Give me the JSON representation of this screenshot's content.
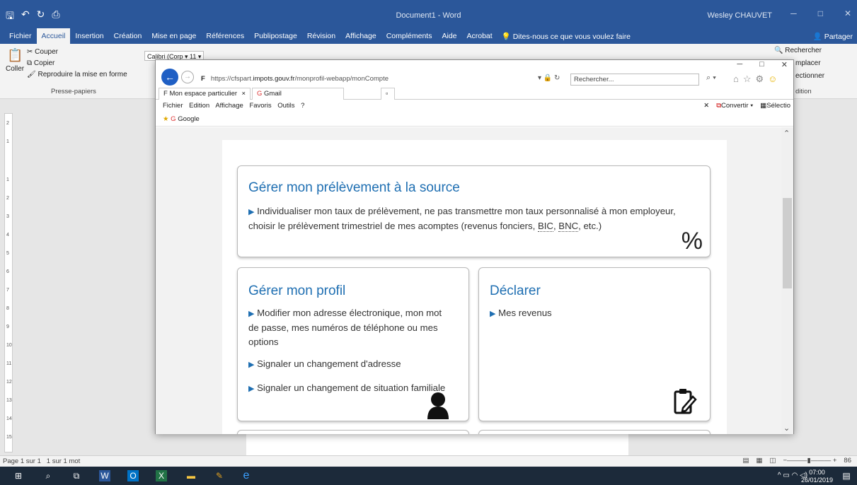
{
  "word": {
    "title": "Document1  -  Word",
    "user": "Wesley CHAUVET",
    "tabs": [
      "Fichier",
      "Accueil",
      "Insertion",
      "Création",
      "Mise en page",
      "Références",
      "Publipostage",
      "Révision",
      "Affichage",
      "Compléments",
      "Aide",
      "Acrobat"
    ],
    "active_tab": "Accueil",
    "tell_me": "Dites-nous ce que vous voulez faire",
    "share": "Partager",
    "ribbon": {
      "paste": "Coller",
      "cut": "Couper",
      "copy": "Copier",
      "format_painter": "Reproduire la mise en forme",
      "clipboard_group": "Presse-papiers",
      "font_name": "Calibri (Corp",
      "font_size": "11",
      "find": "Rechercher",
      "replace": "mplacer",
      "select": "ectionner",
      "editing_group": "dition"
    },
    "status": {
      "page": "Page 1 sur 1",
      "words": "1 sur 1 mot",
      "zoom": "86"
    },
    "vruler": [
      "2",
      "1",
      "1",
      "2",
      "3",
      "4",
      "5",
      "6",
      "7",
      "8",
      "9",
      "10",
      "11",
      "12",
      "13",
      "14",
      "15"
    ]
  },
  "taskbar": {
    "time": "07:00",
    "date": "26/01/2019"
  },
  "ie": {
    "url_prefix": "https://cfspart.",
    "url_domain": "impots.gouv.fr",
    "url_path": "/monprofil-webapp/monCompte",
    "search_placeholder": "Rechercher...",
    "tabs": [
      {
        "label": "Mon espace particulier"
      },
      {
        "label": "Gmail"
      }
    ],
    "menu": [
      "Fichier",
      "Edition",
      "Affichage",
      "Favoris",
      "Outils",
      "?"
    ],
    "convert": "Convertir",
    "select": "Sélectio",
    "fav": "Google"
  },
  "content": {
    "card1": {
      "title": "Gérer mon prélèvement à la source",
      "text_a": "Individualiser mon taux de prélèvement, ne pas transmettre mon taux personnalisé à mon employeur,",
      "text_b": "choisir le prélèvement trimestriel de mes acomptes (revenus fonciers, ",
      "bic": "BIC",
      "sep": ", ",
      "bnc": "BNC",
      "text_c": ", etc.)",
      "icon": "%"
    },
    "card2": {
      "title": "Gérer mon profil",
      "l1a": "Modifier mon adresse électronique, mon mot",
      "l1b": "de passe, mes numéros de téléphone ou mes",
      "l1c": "options",
      "l2": "Signaler un changement d'adresse",
      "l3": "Signaler un changement de situation familiale"
    },
    "card3": {
      "title": "Déclarer",
      "l1": "Mes revenus"
    }
  }
}
